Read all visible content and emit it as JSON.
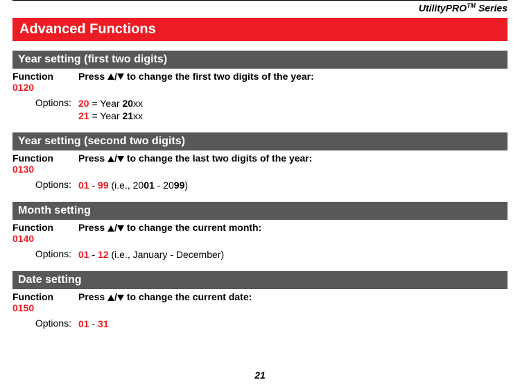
{
  "header": {
    "series_prefix": "UtilityPRO",
    "series_tm": "TM",
    "series_suffix": " Series",
    "banner": "Advanced Functions"
  },
  "labels": {
    "function": "Function",
    "options": "Options:",
    "press_prefix": "Press ",
    "slash": "/"
  },
  "sections": [
    {
      "title": "Year setting (first two digits)",
      "code": "0120",
      "press_suffix": " to change the first two digits of the year:",
      "options_html": [
        {
          "t": "20",
          "c": "red"
        },
        {
          "t": " = Year ",
          "c": "norm"
        },
        {
          "t": "20",
          "c": "blk"
        },
        {
          "t": "xx",
          "c": "norm"
        }
      ],
      "options_html2": [
        {
          "t": "21",
          "c": "red"
        },
        {
          "t": " = Year ",
          "c": "norm"
        },
        {
          "t": "21",
          "c": "blk"
        },
        {
          "t": "xx",
          "c": "norm"
        }
      ]
    },
    {
      "title": "Year setting (second two digits)",
      "code": "0130",
      "press_suffix": " to change the last two digits of the year:",
      "options_html": [
        {
          "t": "01",
          "c": "red"
        },
        {
          "t": " - ",
          "c": "norm"
        },
        {
          "t": "99",
          "c": "red"
        },
        {
          "t": " (i.e., 20",
          "c": "norm"
        },
        {
          "t": "01",
          "c": "blk"
        },
        {
          "t": " - 20",
          "c": "norm"
        },
        {
          "t": "99",
          "c": "blk"
        },
        {
          "t": ")",
          "c": "norm"
        }
      ]
    },
    {
      "title": "Month setting",
      "code": "0140",
      "press_suffix": " to change the current month:",
      "options_html": [
        {
          "t": "01",
          "c": "red"
        },
        {
          "t": " - ",
          "c": "norm"
        },
        {
          "t": "12",
          "c": "red"
        },
        {
          "t": " (i.e., January - December)",
          "c": "norm"
        }
      ]
    },
    {
      "title": "Date setting",
      "code": "0150",
      "press_suffix": " to change the current date:",
      "options_html": [
        {
          "t": "01",
          "c": "red"
        },
        {
          "t": " - ",
          "c": "norm"
        },
        {
          "t": "31",
          "c": "red"
        }
      ]
    }
  ],
  "page_number": "21"
}
